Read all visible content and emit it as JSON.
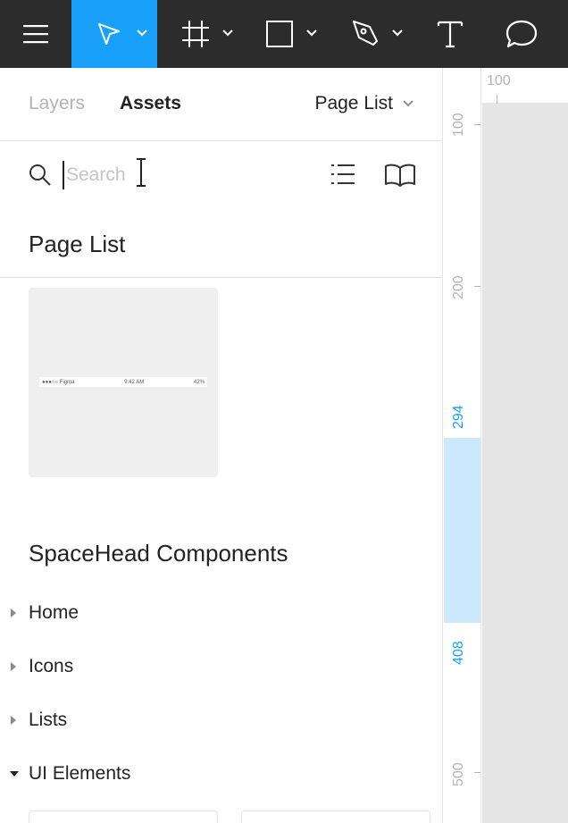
{
  "toolbar": {
    "tools": [
      {
        "name": "menu",
        "icon": "hamburger-menu-icon"
      },
      {
        "name": "move",
        "icon": "move-arrow-icon",
        "active": true
      },
      {
        "name": "frame",
        "icon": "frame-icon"
      },
      {
        "name": "shape",
        "icon": "rectangle-icon"
      },
      {
        "name": "pen",
        "icon": "pen-icon"
      },
      {
        "name": "text",
        "icon": "text-icon"
      },
      {
        "name": "comment",
        "icon": "comment-icon"
      }
    ],
    "bg_color": "#2c2c2c",
    "accent_color": "#18a0fb"
  },
  "panel": {
    "tabs": {
      "layers": "Layers",
      "assets": "Assets"
    },
    "page_select": "Page List",
    "search": {
      "placeholder": "Search",
      "value": ""
    },
    "current_page_title": "Page List",
    "thumbnail": {
      "status_left": "●●●○○ Figma",
      "status_center": "9:42 AM",
      "status_right": "42%"
    },
    "library_title": "SpaceHead Components",
    "groups": [
      {
        "label": "Home",
        "expanded": false
      },
      {
        "label": "Icons",
        "expanded": false
      },
      {
        "label": "Lists",
        "expanded": false
      },
      {
        "label": "UI Elements",
        "expanded": true
      }
    ]
  },
  "ruler": {
    "top_label": "100",
    "labels": {
      "l100": "100",
      "l200": "200",
      "l294": "294",
      "l408": "408",
      "l500": "500"
    },
    "highlight_color": "#cce8fd"
  }
}
